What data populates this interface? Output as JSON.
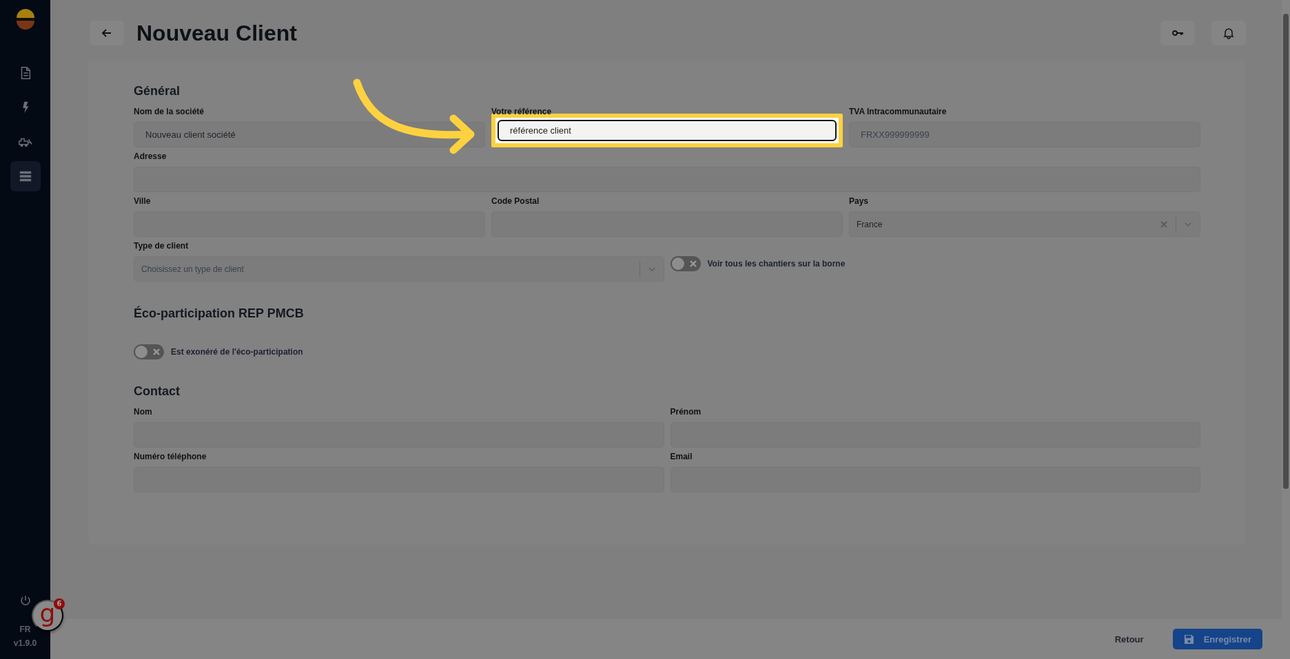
{
  "sidebar": {
    "nav_items": [
      {
        "selected": false
      },
      {
        "selected": false
      },
      {
        "selected": false
      },
      {
        "selected": true
      }
    ],
    "language": "FR",
    "version": "v1.9.0"
  },
  "help_badge": {
    "logo": "g",
    "count": "6"
  },
  "header": {
    "title": "Nouveau Client"
  },
  "sections": [
    {
      "title": "Général",
      "rows": [
        [
          {
            "kind": "text",
            "label": "Nom de la société",
            "value": "Nouveau client société"
          },
          {
            "kind": "text",
            "label": "Votre référence",
            "value": "référence client",
            "highlighted": true
          },
          {
            "kind": "text",
            "label": "TVA Intracommunautaire",
            "placeholder": "FRXX999999999"
          }
        ],
        [
          {
            "kind": "text",
            "label": "Adresse"
          }
        ],
        [
          {
            "kind": "text",
            "label": "Ville"
          },
          {
            "kind": "text",
            "label": "Code Postal"
          },
          {
            "kind": "select",
            "label": "Pays",
            "value": "France",
            "clearable": true
          }
        ],
        [
          {
            "kind": "select",
            "label": "Type de client",
            "placeholder": "Choisissez un type de client",
            "clearable": false
          },
          {
            "kind": "toggle",
            "label": "Voir tous les chantiers sur la borne",
            "on": false
          }
        ]
      ]
    },
    {
      "title": "Éco-participation REP PMCB",
      "rows": [
        [
          {
            "kind": "toggle",
            "label": "Est exonéré de l'éco-participation",
            "on": false
          }
        ]
      ]
    },
    {
      "title": "Contact",
      "rows": [
        [
          {
            "kind": "text",
            "label": "Nom"
          },
          {
            "kind": "text",
            "label": "Prénom"
          }
        ],
        [
          {
            "kind": "text",
            "label": "Numéro téléphone"
          },
          {
            "kind": "text",
            "label": "Email"
          }
        ]
      ]
    }
  ],
  "footer": {
    "cancel": "Retour",
    "save": "Enregistrer"
  }
}
